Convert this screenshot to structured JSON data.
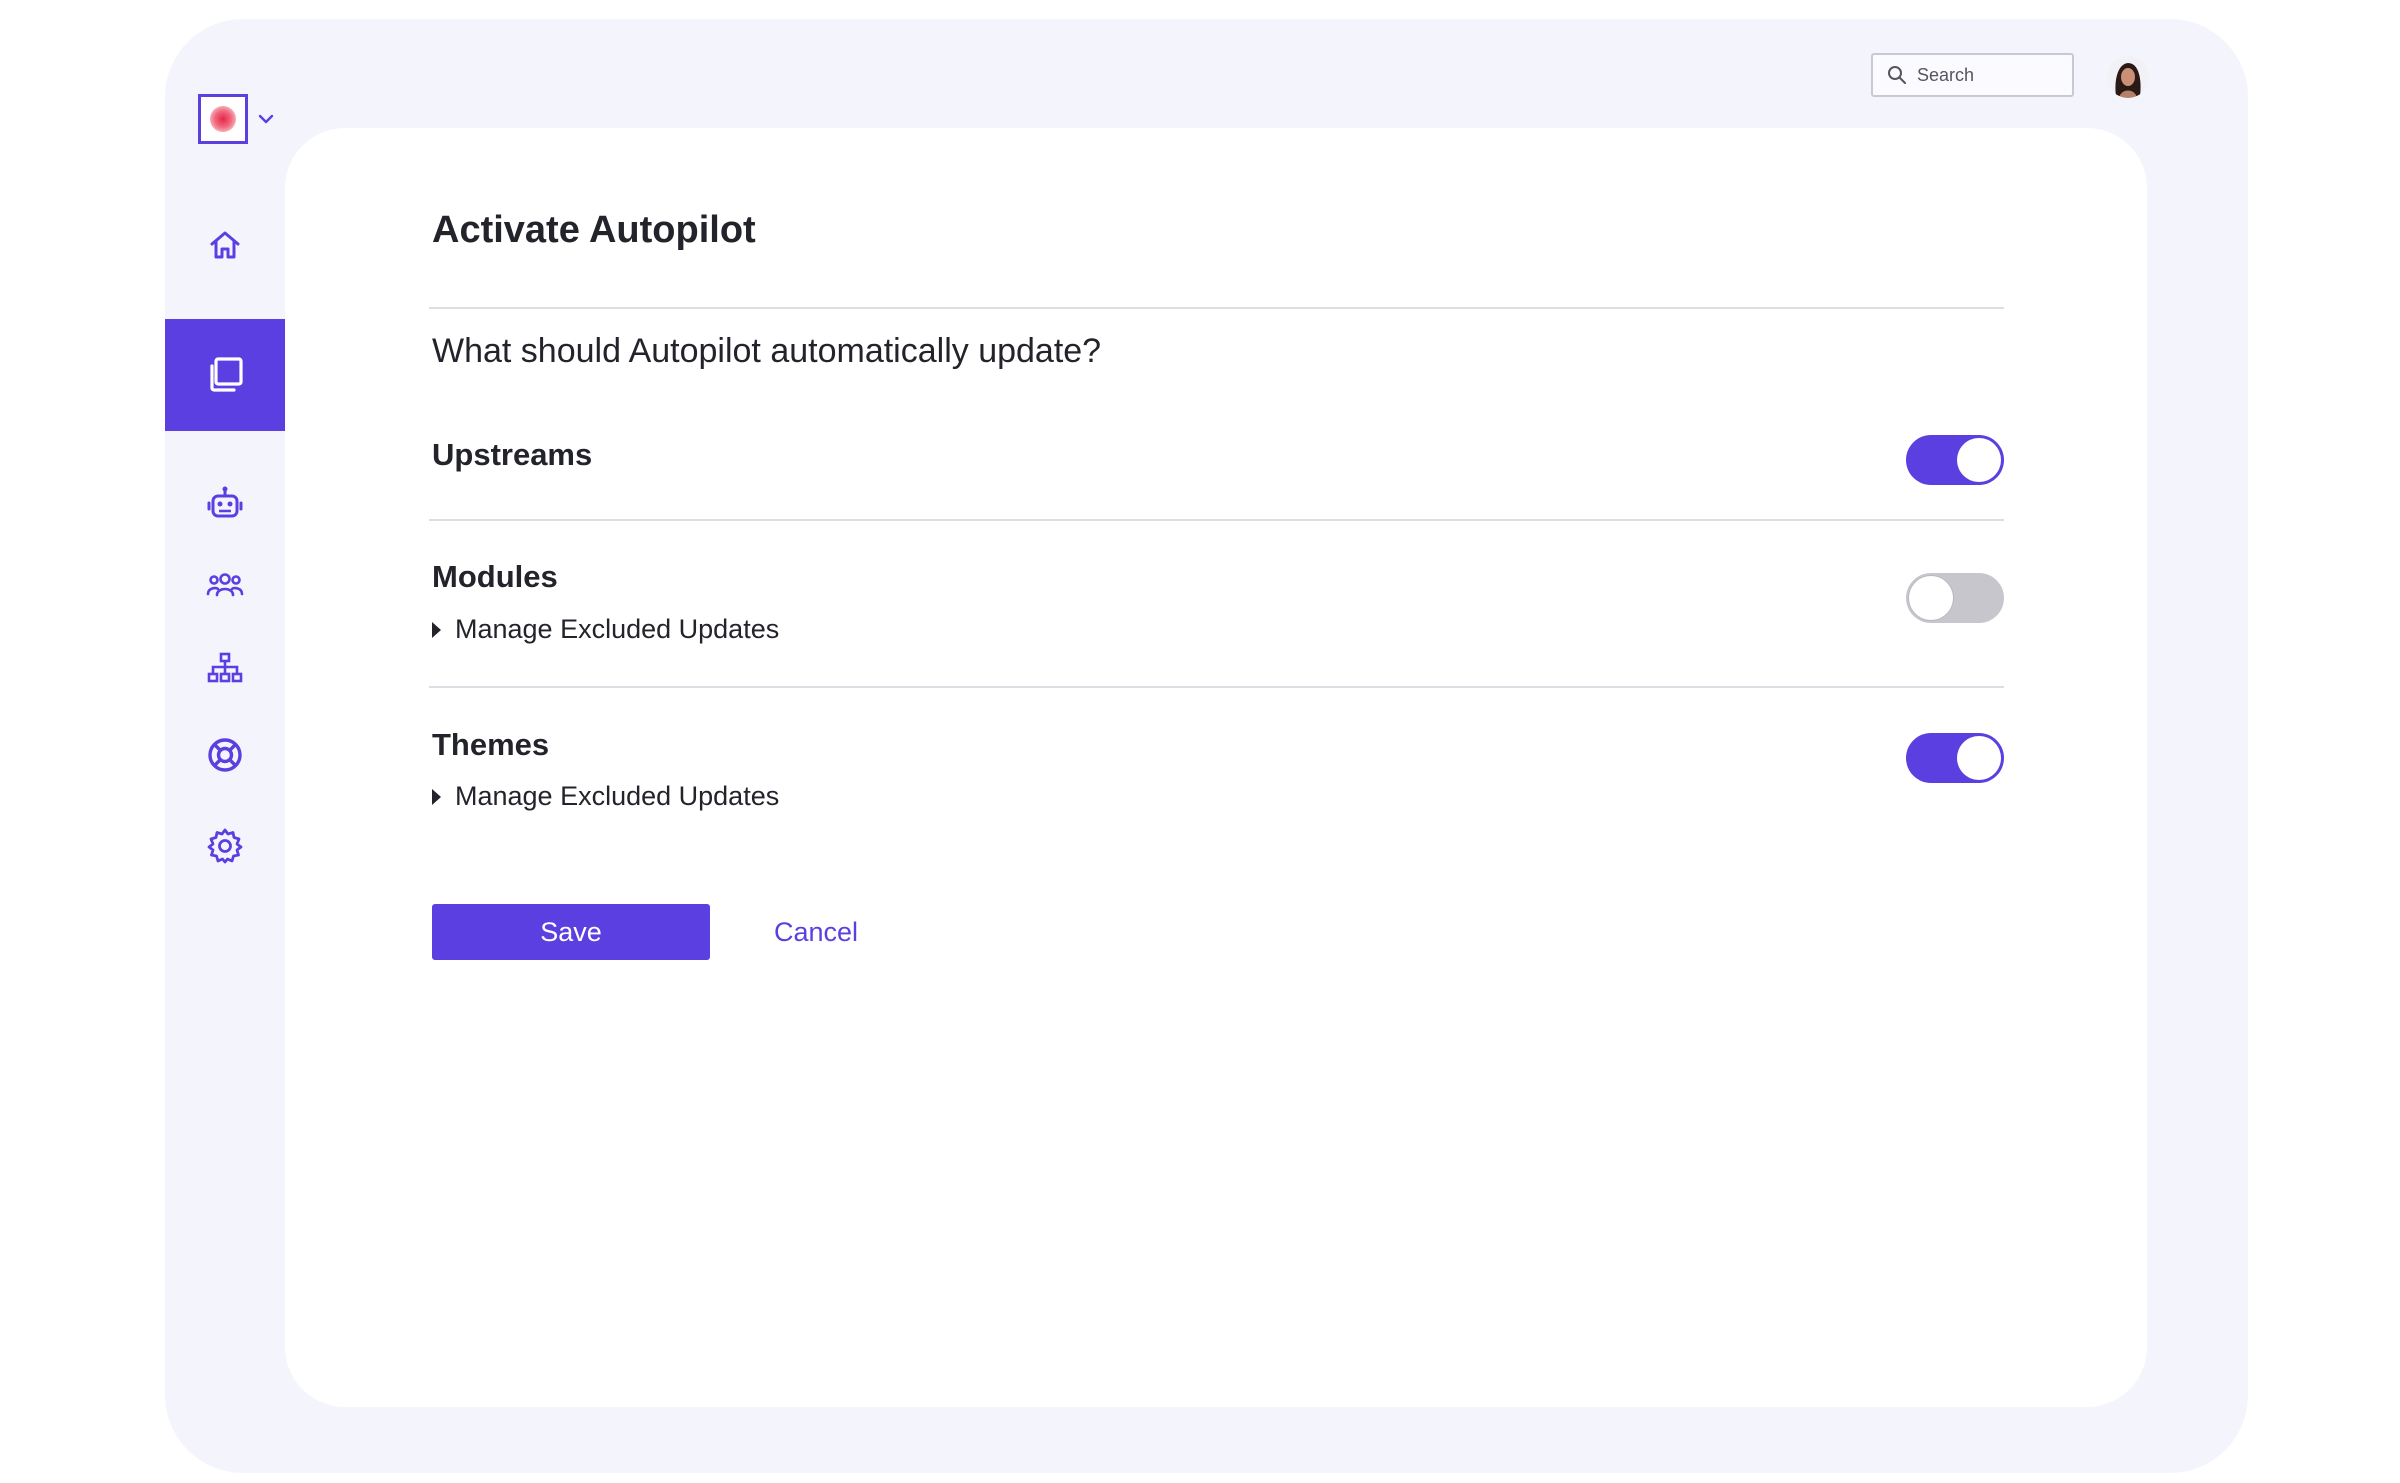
{
  "colors": {
    "accent": "#5b3fe0",
    "frame_bg": "#f4f4fd",
    "toggle_off": "#c6c6cc",
    "text": "#23232b"
  },
  "header": {
    "search_placeholder": "Search",
    "search_icon": "search-icon",
    "avatar": "user-avatar"
  },
  "logo": {
    "icon": "brand-logo",
    "dropdown_icon": "chevron-down-icon"
  },
  "sidebar": {
    "items": [
      {
        "name": "home",
        "icon": "home-icon",
        "active": false
      },
      {
        "name": "sites",
        "icon": "copy-pages-icon",
        "active": true
      },
      {
        "name": "autopilot",
        "icon": "robot-icon",
        "active": false
      },
      {
        "name": "team",
        "icon": "users-icon",
        "active": false
      },
      {
        "name": "organization",
        "icon": "sitemap-icon",
        "active": false
      },
      {
        "name": "support",
        "icon": "lifebuoy-icon",
        "active": false
      },
      {
        "name": "settings",
        "icon": "gear-icon",
        "active": false
      }
    ]
  },
  "main": {
    "title": "Activate Autopilot",
    "question": "What should Autopilot automatically update?",
    "sections": [
      {
        "label": "Upstreams",
        "enabled": true
      },
      {
        "label": "Modules",
        "enabled": false,
        "expander": "Manage Excluded Updates"
      },
      {
        "label": "Themes",
        "enabled": true,
        "expander": "Manage Excluded Updates"
      }
    ],
    "save_label": "Save",
    "cancel_label": "Cancel"
  }
}
